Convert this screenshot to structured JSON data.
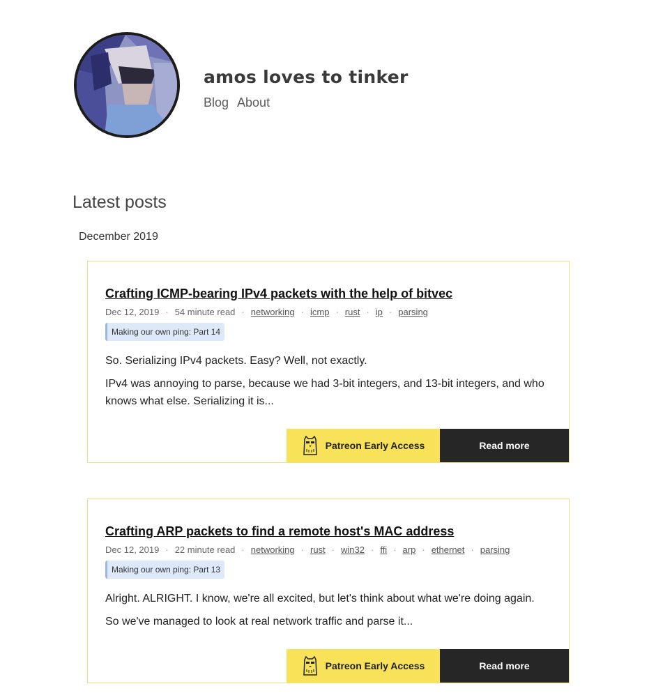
{
  "site": {
    "title": "amos loves to tinker",
    "nav": [
      {
        "label": "Blog"
      },
      {
        "label": "About"
      }
    ]
  },
  "section_title": "Latest posts",
  "month": "December 2019",
  "posts": [
    {
      "title": "Crafting ICMP-bearing IPv4 packets with the help of bitvec",
      "date": "Dec 12, 2019",
      "read_time": "54 minute read",
      "tags": [
        "networking",
        "icmp",
        "rust",
        "ip",
        "parsing"
      ],
      "series": "Making our own ping: Part 14",
      "excerpt": [
        "So. Serializing IPv4 packets. Easy? Well, not exactly.",
        "IPv4 was annoying to parse, because we had 3-bit integers, and 13-bit integers, and who knows what else. Serializing it is..."
      ],
      "patreon_label": "Patreon Early Access",
      "read_more_label": "Read more"
    },
    {
      "title": "Crafting ARP packets to find a remote host's MAC address",
      "date": "Dec 12, 2019",
      "read_time": "22 minute read",
      "tags": [
        "networking",
        "rust",
        "win32",
        "ffi",
        "arp",
        "ethernet",
        "parsing"
      ],
      "series": "Making our own ping: Part 13",
      "excerpt": [
        "Alright. ALRIGHT. I know, we're all excited, but let's think about what we're doing again.",
        "So we've managed to look at real network traffic and parse it..."
      ],
      "patreon_label": "Patreon Early Access",
      "read_more_label": "Read more"
    }
  ],
  "colors": {
    "card_border": "#f0e07a",
    "patreon_bg": "#f7e25a",
    "read_more_bg": "#262626",
    "series_bg": "#dde8f9"
  },
  "icons": {
    "patreon": "bear-icon",
    "avatar": "low-poly-portrait"
  }
}
